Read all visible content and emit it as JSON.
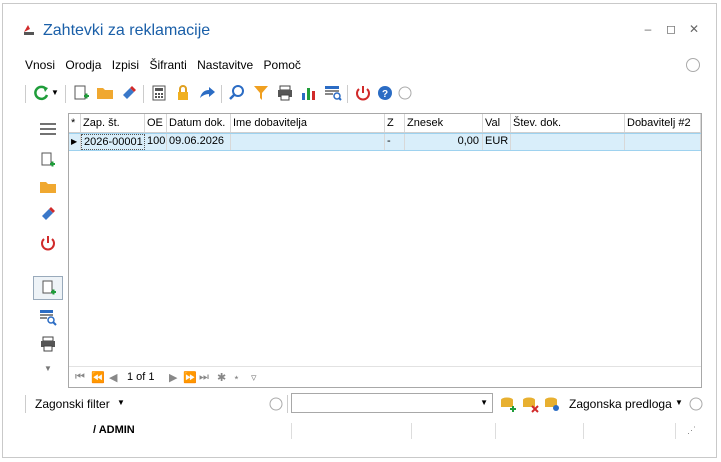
{
  "window": {
    "title": "Zahtevki za reklamacije"
  },
  "menu": [
    {
      "label": "Vnosi"
    },
    {
      "label": "Orodja"
    },
    {
      "label": "Izpisi"
    },
    {
      "label": "Šifranti"
    },
    {
      "label": "Nastavitve"
    },
    {
      "label": "Pomoč"
    }
  ],
  "grid": {
    "columns": [
      "Zap. št.",
      "OE",
      "Datum dok.",
      "Ime dobavitelja",
      "Z",
      "Znesek",
      "Val",
      "Štev. dok.",
      "Dobavitelj #2"
    ],
    "rows": [
      [
        "2026-00001",
        "100",
        "09.06.2026",
        "",
        "-",
        "0,00",
        "EUR",
        "",
        ""
      ]
    ],
    "row_marker_header": "*",
    "pager": "1 of 1"
  },
  "filter": {
    "label": "Zagonski filter",
    "template_label": "Zagonska predloga",
    "combo_value": ""
  },
  "status": {
    "user": "/ ADMIN"
  },
  "colors": {
    "title": "#1a5fa8",
    "selected_row": "#d9eefa",
    "power": "#d12a2a",
    "help": "#2b6cc4",
    "refresh": "#1f9d3a"
  }
}
